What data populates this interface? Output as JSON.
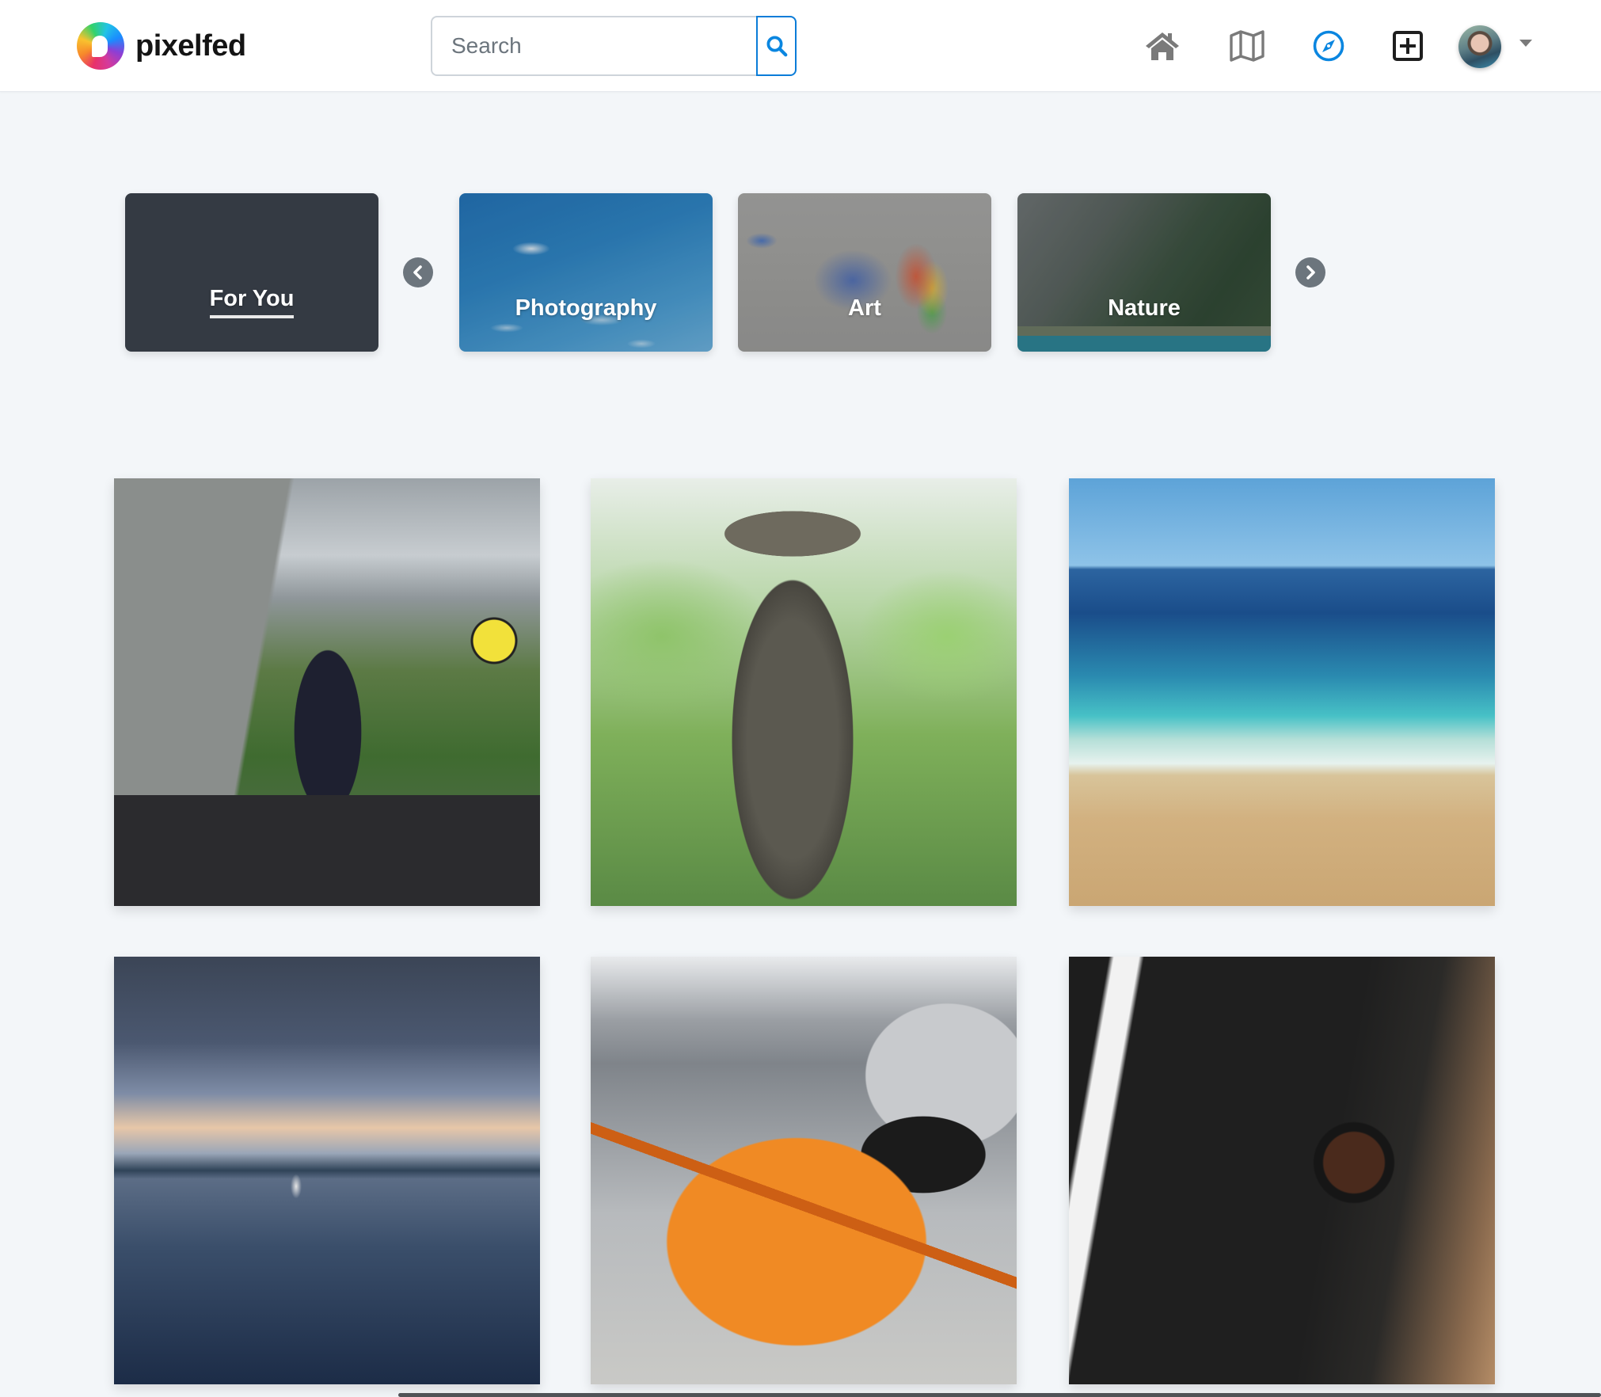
{
  "header": {
    "brand": {
      "name": "pixelfed",
      "logo_icon": "pixelfed-logo-icon"
    },
    "search": {
      "placeholder": "Search",
      "value": "",
      "button_icon": "search-icon"
    },
    "nav": [
      {
        "id": "home",
        "icon": "home-icon",
        "label": "Home",
        "color": "#7a7a7a",
        "active": false
      },
      {
        "id": "map",
        "icon": "map-icon",
        "label": "Map",
        "color": "#7a7a7a",
        "active": false
      },
      {
        "id": "discover",
        "icon": "compass-icon",
        "label": "Discover",
        "color": "#0a86e0",
        "active": true
      },
      {
        "id": "new-post",
        "icon": "plus-square-icon",
        "label": "New Post",
        "color": "#1e1e1e",
        "active": false
      }
    ],
    "profile": {
      "avatar_icon": "avatar",
      "menu_icon": "caret-down-icon"
    }
  },
  "categories": {
    "prev_icon": "chevron-left-icon",
    "next_icon": "chevron-right-icon",
    "items": [
      {
        "label": "For You",
        "active": true
      },
      {
        "label": "Photography",
        "active": false
      },
      {
        "label": "Art",
        "active": false
      },
      {
        "label": "Nature",
        "active": false
      }
    ]
  },
  "grid": {
    "posts": [
      {
        "subject": "Woman on pickup truck on rural road"
      },
      {
        "subject": "Stone statue with leaves"
      },
      {
        "subject": "Beach with turquoise sea"
      },
      {
        "subject": "River with boat at dusk"
      },
      {
        "subject": "Orange muscle car in parking garage"
      },
      {
        "subject": "Close-up of dog eye"
      }
    ]
  },
  "colors": {
    "accent": "#0a86e0",
    "background": "#f3f6f9",
    "for_you_card": "#343a43",
    "carousel_arrow": "#6c757d"
  }
}
